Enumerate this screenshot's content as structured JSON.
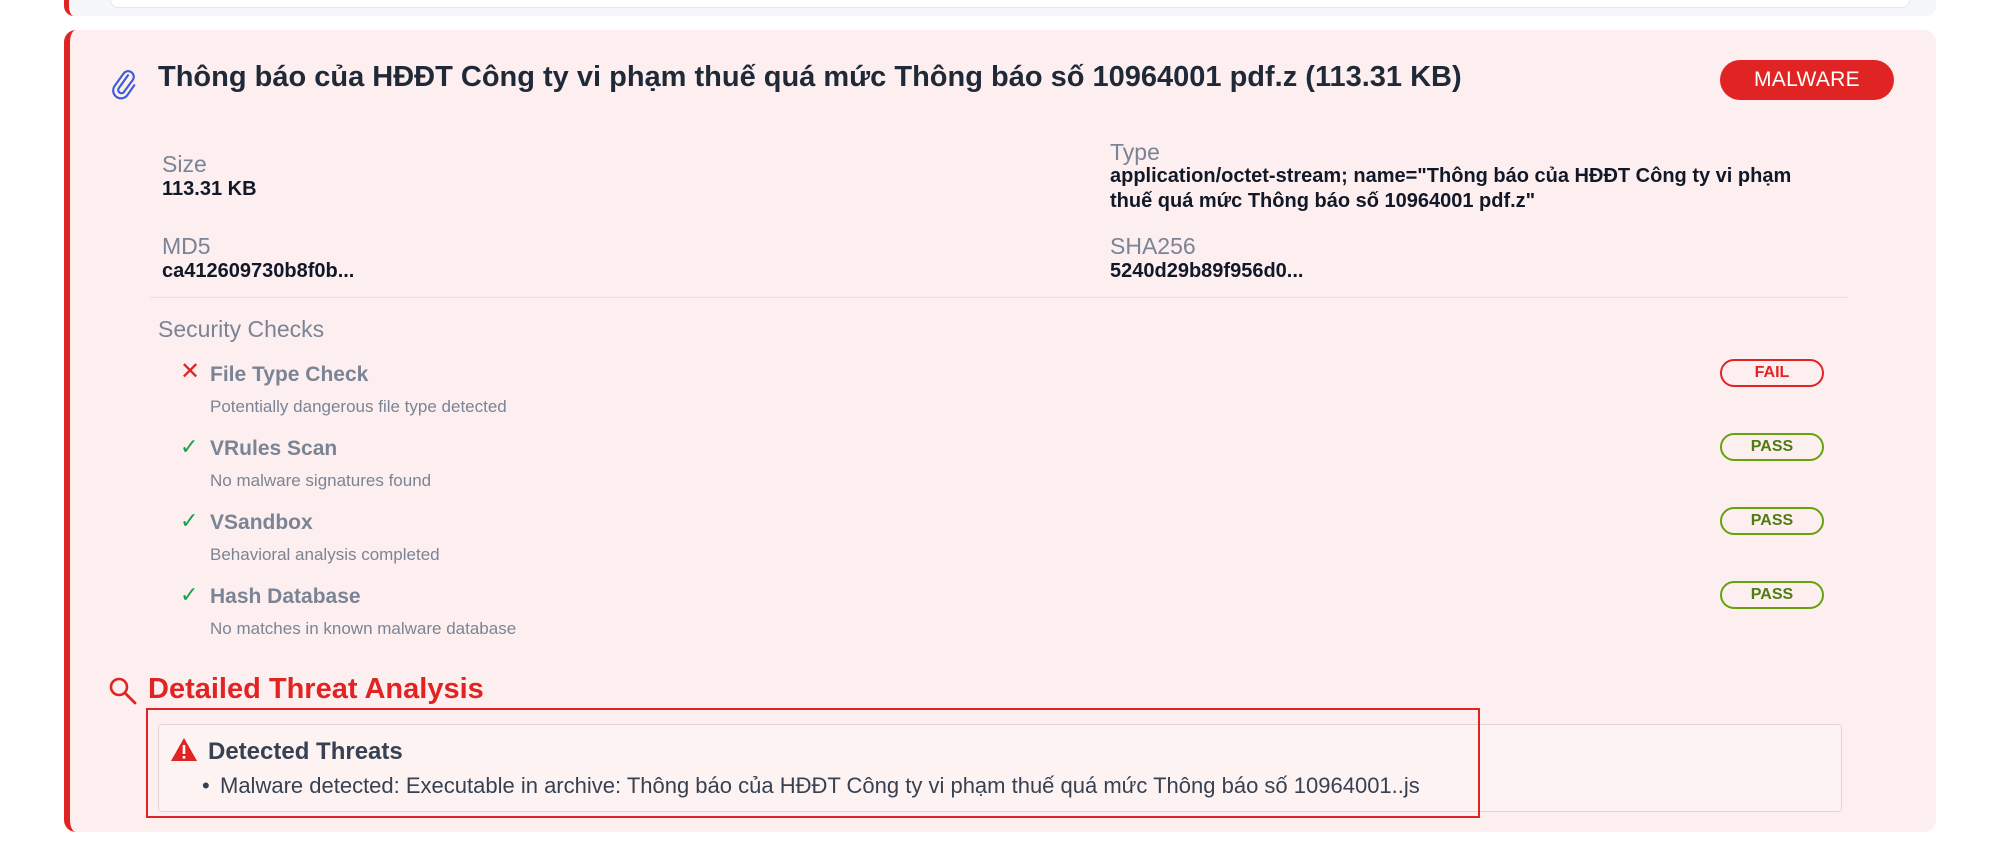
{
  "attachment": {
    "title": "Thông báo của HĐĐT Công ty vi phạm thuế quá mức Thông báo số 10964001 pdf.z (113.31 KB)",
    "verdict": "MALWARE",
    "icon": "paperclip-icon",
    "accent_color": "#e02424"
  },
  "metadata": {
    "size_label": "Size",
    "size_value": "113.31 KB",
    "type_label": "Type",
    "type_value_line1": "application/octet-stream; name=\"Thông báo của HĐĐT Công ty vi phạm",
    "type_value_line2": "thuế quá mức Thông báo số 10964001 pdf.z\"",
    "md5_label": "MD5",
    "md5_value": "ca412609730b8f0b...",
    "sha256_label": "SHA256",
    "sha256_value": "5240d29b89f956d0..."
  },
  "security_checks": {
    "title": "Security Checks",
    "items": [
      {
        "name": "File Type Check",
        "description": "Potentially dangerous file type detected",
        "status": "FAIL",
        "icon": "x-icon"
      },
      {
        "name": "VRules Scan",
        "description": "No malware signatures found",
        "status": "PASS",
        "icon": "check-icon"
      },
      {
        "name": "VSandbox",
        "description": "Behavioral analysis completed",
        "status": "PASS",
        "icon": "check-icon"
      },
      {
        "name": "Hash Database",
        "description": "No matches in known malware database",
        "status": "PASS",
        "icon": "check-icon"
      }
    ]
  },
  "threat_analysis": {
    "heading": "Detailed Threat Analysis",
    "icon": "search-icon",
    "detected_title": "Detected Threats",
    "detected_icon": "warning-icon",
    "items": [
      "Malware detected: Executable in archive: Thông báo của HĐĐT Công ty vi phạm thuế quá mức Thông báo số 10964001..js"
    ]
  }
}
